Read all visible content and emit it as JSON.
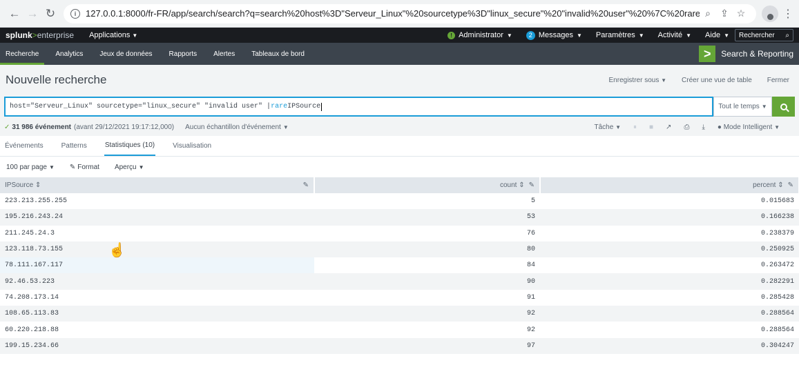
{
  "browser": {
    "url": "127.0.0.1:8000/fr-FR/app/search/search?q=search%20host%3D\"Serveur_Linux\"%20sourcetype%3D\"linux_secure\"%20\"invalid%20user\"%20%7C%20rare%2..."
  },
  "splunk": {
    "logo_brand": "splunk",
    "logo_sep": ">",
    "logo_product": "enterprise",
    "apps_menu": "Applications",
    "admin": "Administrator",
    "messages_count": "2",
    "messages": "Messages",
    "settings": "Paramètres",
    "activity": "Activité",
    "help": "Aide",
    "search_placeholder": "Rechercher"
  },
  "app_nav": {
    "tabs": [
      "Recherche",
      "Analytics",
      "Jeux de données",
      "Rapports",
      "Alertes",
      "Tableaux de bord"
    ],
    "app_name": "Search & Reporting"
  },
  "page": {
    "title": "Nouvelle recherche",
    "save_as": "Enregistrer sous",
    "create_table": "Créer une vue de table",
    "close": "Fermer"
  },
  "search": {
    "query_main": "host=\"Serveur_Linux\" sourcetype=\"linux_secure\" \"invalid user\" | ",
    "query_cmd": "rare",
    "query_field": " IPSource",
    "time_range": "Tout le temps"
  },
  "status": {
    "count": "31 986 événement",
    "before": "(avant 29/12/2021 19:17:12,000)",
    "sampling": "Aucun échantillon d'événement",
    "job": "Tâche",
    "mode": "Mode Intelligent"
  },
  "tabs": {
    "events": "Événements",
    "patterns": "Patterns",
    "stats": "Statistiques (10)",
    "viz": "Visualisation"
  },
  "options": {
    "per_page": "100 par page",
    "format": "Format",
    "preview": "Aperçu"
  },
  "table": {
    "columns": [
      "IPSource",
      "count",
      "percent"
    ],
    "rows": [
      [
        "223.213.255.255",
        "5",
        "0.015683"
      ],
      [
        "195.216.243.24",
        "53",
        "0.166238"
      ],
      [
        "211.245.24.3",
        "76",
        "0.238379"
      ],
      [
        "123.118.73.155",
        "80",
        "0.250925"
      ],
      [
        "78.111.167.117",
        "84",
        "0.263472"
      ],
      [
        "92.46.53.223",
        "90",
        "0.282291"
      ],
      [
        "74.208.173.14",
        "91",
        "0.285428"
      ],
      [
        "108.65.113.83",
        "92",
        "0.288564"
      ],
      [
        "60.220.218.88",
        "92",
        "0.288564"
      ],
      [
        "199.15.234.66",
        "97",
        "0.304247"
      ]
    ]
  }
}
